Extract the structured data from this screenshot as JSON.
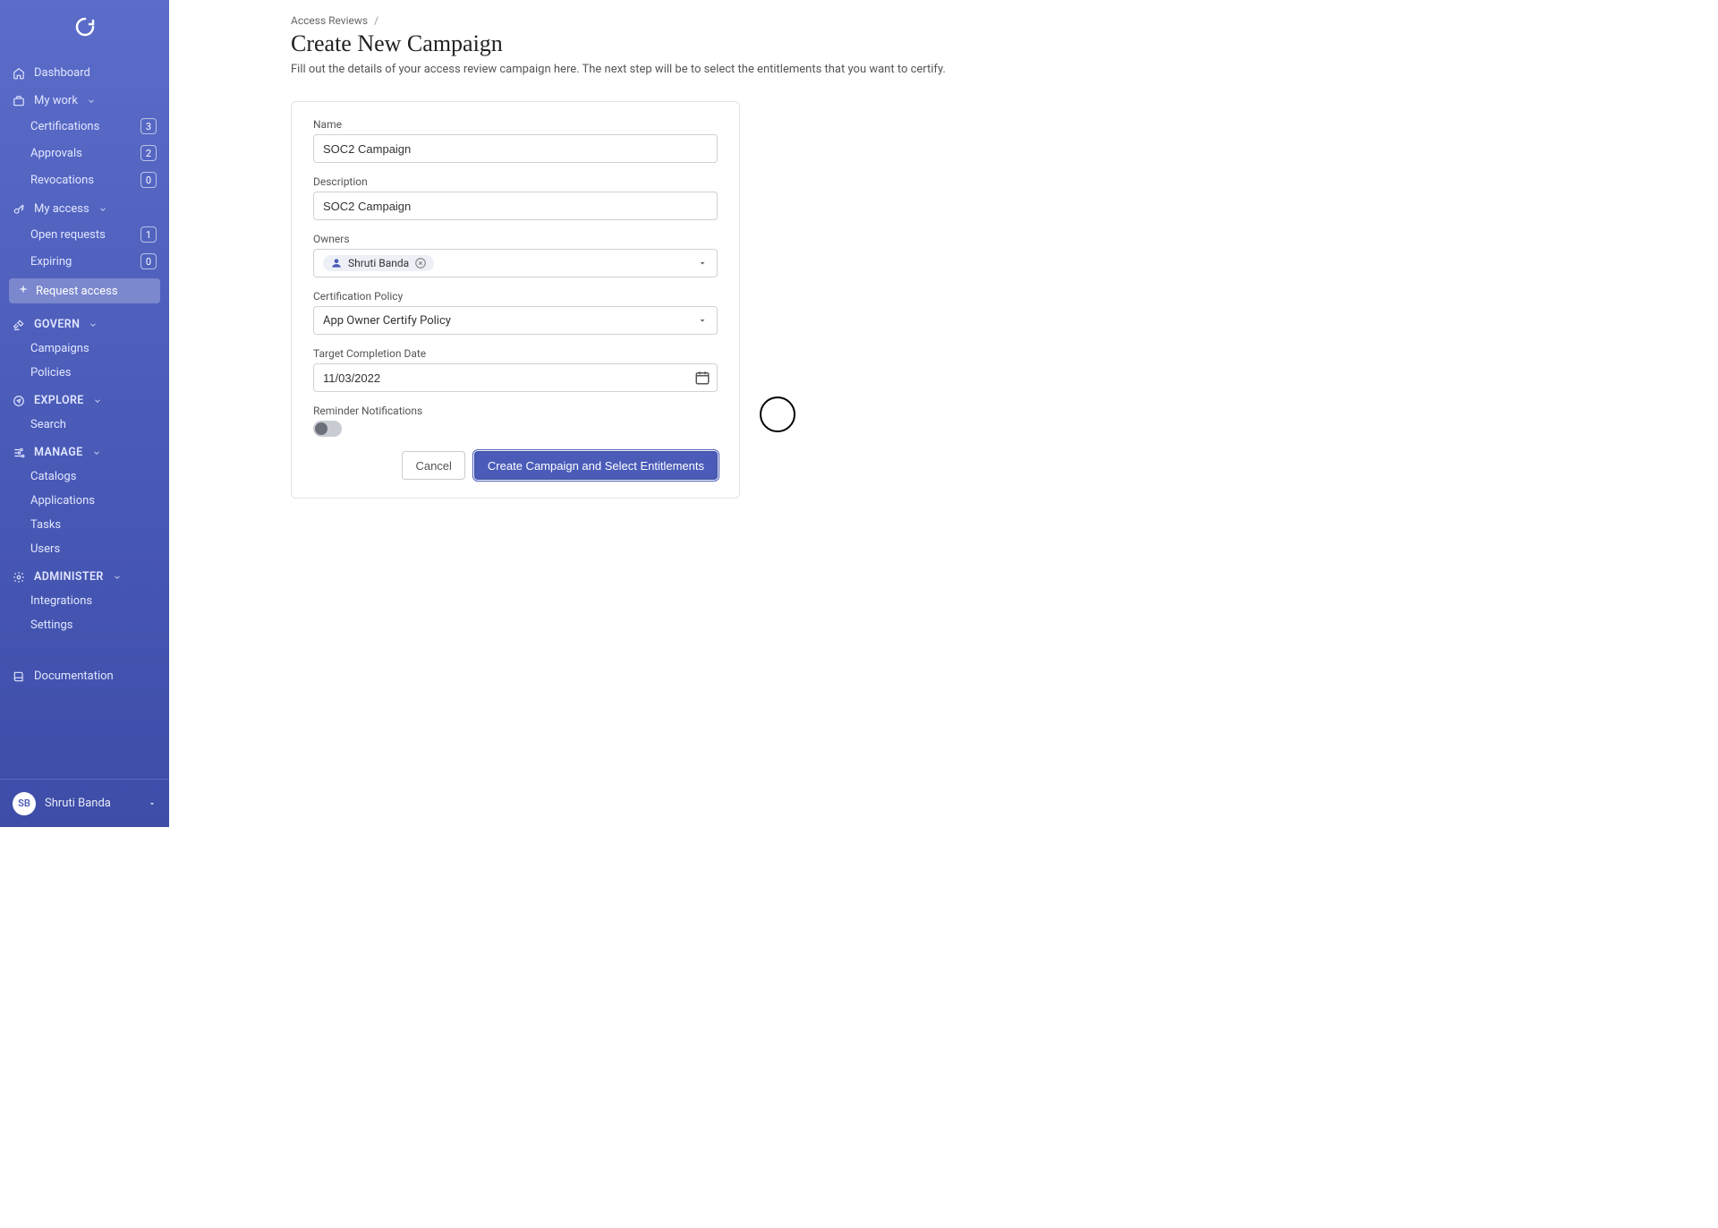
{
  "sidebar": {
    "dashboard_label": "Dashboard",
    "mywork_label": "My work",
    "mywork_items": [
      {
        "label": "Certifications",
        "badge": "3"
      },
      {
        "label": "Approvals",
        "badge": "2"
      },
      {
        "label": "Revocations",
        "badge": "0"
      }
    ],
    "myaccess_label": "My access",
    "myaccess_items": [
      {
        "label": "Open requests",
        "badge": "1"
      },
      {
        "label": "Expiring",
        "badge": "0"
      }
    ],
    "request_access_label": "Request access",
    "govern_label": "GOVERN",
    "govern_items": [
      {
        "label": "Campaigns"
      },
      {
        "label": "Policies"
      }
    ],
    "explore_label": "EXPLORE",
    "explore_items": [
      {
        "label": "Search"
      }
    ],
    "manage_label": "MANAGE",
    "manage_items": [
      {
        "label": "Catalogs"
      },
      {
        "label": "Applications"
      },
      {
        "label": "Tasks"
      },
      {
        "label": "Users"
      }
    ],
    "administer_label": "ADMINISTER",
    "administer_items": [
      {
        "label": "Integrations"
      },
      {
        "label": "Settings"
      }
    ],
    "documentation_label": "Documentation"
  },
  "user": {
    "initials": "SB",
    "name": "Shruti Banda"
  },
  "breadcrumb": {
    "parent": "Access Reviews",
    "sep": "/"
  },
  "page": {
    "title": "Create New Campaign",
    "subtitle": "Fill out the details of your access review campaign here. The next step will be to select the entitlements that you want to certify."
  },
  "form": {
    "name_label": "Name",
    "name_value": "SOC2 Campaign",
    "description_label": "Description",
    "description_value": "SOC2 Campaign",
    "owners_label": "Owners",
    "owner_chip": "Shruti Banda",
    "cert_policy_label": "Certification Policy",
    "cert_policy_value": "App Owner Certify Policy",
    "target_date_label": "Target Completion Date",
    "target_date_value": "11/03/2022",
    "reminder_label": "Reminder Notifications",
    "cancel_label": "Cancel",
    "submit_label": "Create Campaign and Select Entitlements"
  }
}
